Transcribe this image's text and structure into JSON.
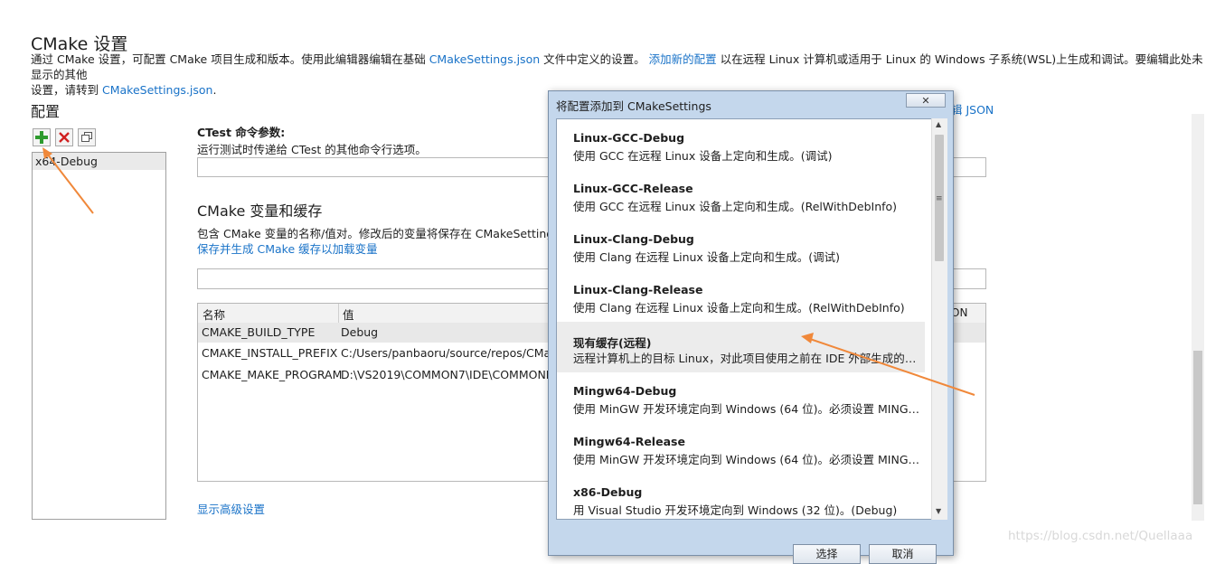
{
  "page": {
    "title": "CMake 设置",
    "desc_part1": "通过 CMake 设置，可配置 CMake 项目生成和版本。使用此编辑器编辑在基础 ",
    "desc_link1": "CMakeSettings.json",
    "desc_part2": " 文件中定义的设置。 ",
    "desc_link2": "添加新的配置",
    "desc_part3": " 以在远程 Linux 计算机或适用于 Linux 的 Windows 子系统(WSL)上生成和调试。要编辑此处未显示的其他",
    "desc_line2": "设置，请转到 ",
    "desc_link3": "CMakeSettings.json",
    "desc_end": "."
  },
  "config_panel": {
    "heading": "配置",
    "add_icon": "plus-icon",
    "remove_icon": "x-icon",
    "copy_icon": "copy-icon",
    "items": [
      "x64-Debug"
    ]
  },
  "ctest": {
    "title": "CTest 命令参数:",
    "subtitle": "运行测试时传递给 CTest 的其他命令行选项。",
    "value": ""
  },
  "cmake_vars": {
    "title": "CMake 变量和缓存",
    "subtitle": "包含 CMake 变量的名称/值对。修改后的变量将保存在 CMakeSettings.j",
    "save_link": "保存并生成 CMake 缓存以加载变量",
    "filter_value": "",
    "columns": [
      "名称",
      "值",
      "ON"
    ],
    "rows": [
      {
        "name": "CMAKE_BUILD_TYPE",
        "value": "Debug"
      },
      {
        "name": "CMAKE_INSTALL_PREFIX",
        "value": "C:/Users/panbaoru/source/repos/CMake"
      },
      {
        "name": "CMAKE_MAKE_PROGRAM",
        "value": "D:\\VS2019\\COMMON7\\IDE\\COMMONE"
      }
    ]
  },
  "advanced_link": "显示高级设置",
  "json_link": "辑 JSON",
  "dialog": {
    "caption": "将配置添加到 CMakeSettings",
    "close_label": "✕",
    "items": [
      {
        "name": "Linux-GCC-Debug",
        "desc": "使用 GCC 在远程 Linux 设备上定向和生成。(调试)"
      },
      {
        "name": "Linux-GCC-Release",
        "desc": "使用 GCC 在远程 Linux 设备上定向和生成。(RelWithDebInfo)"
      },
      {
        "name": "Linux-Clang-Debug",
        "desc": "使用 Clang 在远程 Linux 设备上定向和生成。(调试)"
      },
      {
        "name": "Linux-Clang-Release",
        "desc": "使用 Clang 在远程 Linux 设备上定向和生成。(RelWithDebInfo)"
      },
      {
        "name": "现有缓存(远程)",
        "desc": "远程计算机上的目标 Linux，对此项目使用之前在 IDE 外部生成的现有..."
      },
      {
        "name": "Mingw64-Debug",
        "desc": "使用 MinGW 开发环境定向到 Windows (64 位)。必须设置 MINGW_..."
      },
      {
        "name": "Mingw64-Release",
        "desc": "使用 MinGW 开发环境定向到 Windows (64 位)。必须设置 MINGW_..."
      },
      {
        "name": "x86-Debug",
        "desc": "用 Visual Studio 开发环境定向到 Windows (32 位)。(Debug)"
      }
    ],
    "selected_index": 4,
    "ok_label": "选择",
    "cancel_label": "取消"
  },
  "watermark": "https://blog.csdn.net/Quellaaa",
  "colors": {
    "link": "#1a73c8",
    "arrow": "#f0883a",
    "dialog_frame": "#c4d7ec"
  }
}
